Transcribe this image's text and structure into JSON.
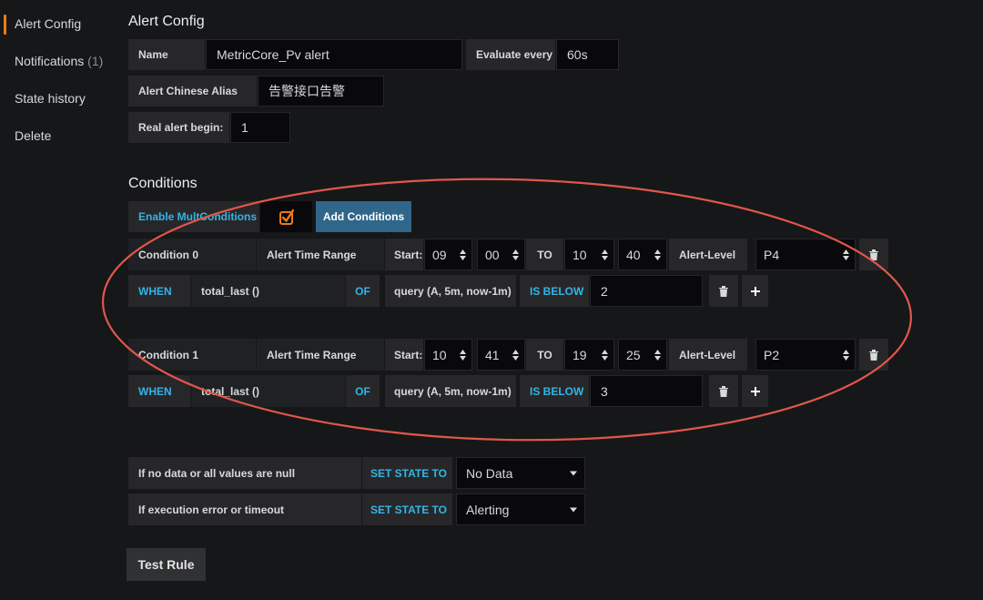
{
  "sidebar": {
    "items": [
      {
        "label": "Alert Config",
        "count": ""
      },
      {
        "label": "Notifications",
        "count": "(1)"
      },
      {
        "label": "State history",
        "count": ""
      },
      {
        "label": "Delete",
        "count": ""
      }
    ]
  },
  "alert_config": {
    "title": "Alert Config",
    "name_label": "Name",
    "name_value": "MetricCore_Pv alert",
    "evaluate_label": "Evaluate every",
    "evaluate_value": "60s",
    "alias_label": "Alert Chinese Alias",
    "alias_value": "告警接口告警",
    "real_begin_label": "Real alert begin:",
    "real_begin_value": "1"
  },
  "conditions": {
    "title": "Conditions",
    "enable_label": "Enable MultConditions",
    "enable_checked": true,
    "add_button": "Add Conditions",
    "items": [
      {
        "name": "Condition 0",
        "time_range_label": "Alert Time Range",
        "start_label": "Start:",
        "start_hour": "09",
        "start_min": "00",
        "to_label": "TO",
        "end_hour": "10",
        "end_min": "40",
        "level_label": "Alert-Level",
        "level": "P4",
        "when_label": "WHEN",
        "reducer": "total_last ()",
        "of_label": "OF",
        "query": "query (A, 5m, now-1m)",
        "evaluator": "IS BELOW",
        "threshold": "2"
      },
      {
        "name": "Condition 1",
        "time_range_label": "Alert Time Range",
        "start_label": "Start:",
        "start_hour": "10",
        "start_min": "41",
        "to_label": "TO",
        "end_hour": "19",
        "end_min": "25",
        "level_label": "Alert-Level",
        "level": "P2",
        "when_label": "WHEN",
        "reducer": "total_last ()",
        "of_label": "OF",
        "query": "query (A, 5m, now-1m)",
        "evaluator": "IS BELOW",
        "threshold": "3"
      }
    ]
  },
  "state_rules": [
    {
      "label": "If no data or all values are null",
      "action": "SET STATE TO",
      "value": "No Data"
    },
    {
      "label": "If execution error or timeout",
      "action": "SET STATE TO",
      "value": "Alerting"
    }
  ],
  "test_button": "Test Rule",
  "colors": {
    "background": "#161719",
    "accent_orange": "#eb7b18",
    "accent_blue": "#33b5e5",
    "primary_button": "#31668b",
    "annotation_ellipse": "#e0574a"
  }
}
